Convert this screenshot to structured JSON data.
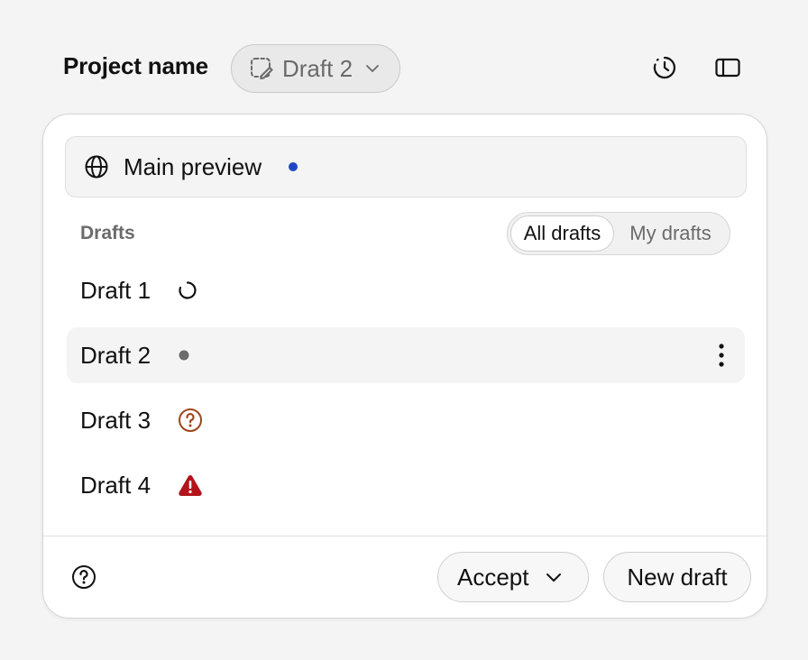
{
  "header": {
    "project_name": "Project name",
    "draft_selector": {
      "label": "Draft 2",
      "icon": "draft-dashed-pencil-icon"
    },
    "actions": [
      {
        "name": "history",
        "icon": "history-icon"
      },
      {
        "name": "toggle-sidebar",
        "icon": "sidebar-icon"
      }
    ]
  },
  "card": {
    "main_preview": {
      "label": "Main preview",
      "icon": "globe-icon",
      "dot_color": "#1f47c4"
    },
    "drafts_heading": "Drafts",
    "filter": {
      "options": [
        "All drafts",
        "My drafts"
      ],
      "selected": "All drafts"
    },
    "drafts": [
      {
        "label": "Draft 1",
        "status": "loading",
        "icon": "spinner-icon"
      },
      {
        "label": "Draft 2",
        "status": "idle",
        "icon": "gray-dot-icon",
        "selected": true
      },
      {
        "label": "Draft 3",
        "status": "question",
        "icon": "question-circle-icon",
        "color": "#a0451a"
      },
      {
        "label": "Draft 4",
        "status": "error",
        "icon": "warning-triangle-icon",
        "color": "#b3141b"
      }
    ],
    "footer": {
      "help_icon": "help-circle-icon",
      "accept_label": "Accept",
      "new_draft_label": "New draft"
    }
  }
}
